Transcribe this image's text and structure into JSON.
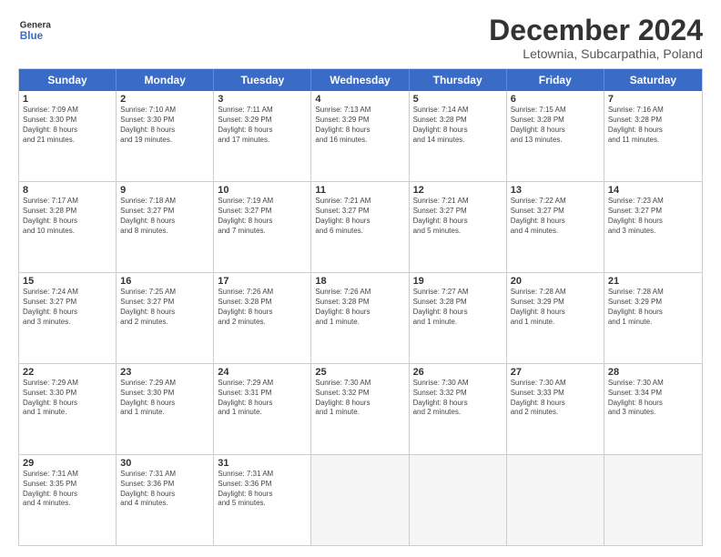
{
  "header": {
    "logo_line1": "General",
    "logo_line2": "Blue",
    "title": "December 2024",
    "subtitle": "Letownia, Subcarpathia, Poland"
  },
  "calendar": {
    "days_of_week": [
      "Sunday",
      "Monday",
      "Tuesday",
      "Wednesday",
      "Thursday",
      "Friday",
      "Saturday"
    ],
    "rows": [
      [
        {
          "day": "1",
          "info": "Sunrise: 7:09 AM\nSunset: 3:30 PM\nDaylight: 8 hours\nand 21 minutes."
        },
        {
          "day": "2",
          "info": "Sunrise: 7:10 AM\nSunset: 3:30 PM\nDaylight: 8 hours\nand 19 minutes."
        },
        {
          "day": "3",
          "info": "Sunrise: 7:11 AM\nSunset: 3:29 PM\nDaylight: 8 hours\nand 17 minutes."
        },
        {
          "day": "4",
          "info": "Sunrise: 7:13 AM\nSunset: 3:29 PM\nDaylight: 8 hours\nand 16 minutes."
        },
        {
          "day": "5",
          "info": "Sunrise: 7:14 AM\nSunset: 3:28 PM\nDaylight: 8 hours\nand 14 minutes."
        },
        {
          "day": "6",
          "info": "Sunrise: 7:15 AM\nSunset: 3:28 PM\nDaylight: 8 hours\nand 13 minutes."
        },
        {
          "day": "7",
          "info": "Sunrise: 7:16 AM\nSunset: 3:28 PM\nDaylight: 8 hours\nand 11 minutes."
        }
      ],
      [
        {
          "day": "8",
          "info": "Sunrise: 7:17 AM\nSunset: 3:28 PM\nDaylight: 8 hours\nand 10 minutes."
        },
        {
          "day": "9",
          "info": "Sunrise: 7:18 AM\nSunset: 3:27 PM\nDaylight: 8 hours\nand 8 minutes."
        },
        {
          "day": "10",
          "info": "Sunrise: 7:19 AM\nSunset: 3:27 PM\nDaylight: 8 hours\nand 7 minutes."
        },
        {
          "day": "11",
          "info": "Sunrise: 7:21 AM\nSunset: 3:27 PM\nDaylight: 8 hours\nand 6 minutes."
        },
        {
          "day": "12",
          "info": "Sunrise: 7:21 AM\nSunset: 3:27 PM\nDaylight: 8 hours\nand 5 minutes."
        },
        {
          "day": "13",
          "info": "Sunrise: 7:22 AM\nSunset: 3:27 PM\nDaylight: 8 hours\nand 4 minutes."
        },
        {
          "day": "14",
          "info": "Sunrise: 7:23 AM\nSunset: 3:27 PM\nDaylight: 8 hours\nand 3 minutes."
        }
      ],
      [
        {
          "day": "15",
          "info": "Sunrise: 7:24 AM\nSunset: 3:27 PM\nDaylight: 8 hours\nand 3 minutes."
        },
        {
          "day": "16",
          "info": "Sunrise: 7:25 AM\nSunset: 3:27 PM\nDaylight: 8 hours\nand 2 minutes."
        },
        {
          "day": "17",
          "info": "Sunrise: 7:26 AM\nSunset: 3:28 PM\nDaylight: 8 hours\nand 2 minutes."
        },
        {
          "day": "18",
          "info": "Sunrise: 7:26 AM\nSunset: 3:28 PM\nDaylight: 8 hours\nand 1 minute."
        },
        {
          "day": "19",
          "info": "Sunrise: 7:27 AM\nSunset: 3:28 PM\nDaylight: 8 hours\nand 1 minute."
        },
        {
          "day": "20",
          "info": "Sunrise: 7:28 AM\nSunset: 3:29 PM\nDaylight: 8 hours\nand 1 minute."
        },
        {
          "day": "21",
          "info": "Sunrise: 7:28 AM\nSunset: 3:29 PM\nDaylight: 8 hours\nand 1 minute."
        }
      ],
      [
        {
          "day": "22",
          "info": "Sunrise: 7:29 AM\nSunset: 3:30 PM\nDaylight: 8 hours\nand 1 minute."
        },
        {
          "day": "23",
          "info": "Sunrise: 7:29 AM\nSunset: 3:30 PM\nDaylight: 8 hours\nand 1 minute."
        },
        {
          "day": "24",
          "info": "Sunrise: 7:29 AM\nSunset: 3:31 PM\nDaylight: 8 hours\nand 1 minute."
        },
        {
          "day": "25",
          "info": "Sunrise: 7:30 AM\nSunset: 3:32 PM\nDaylight: 8 hours\nand 1 minute."
        },
        {
          "day": "26",
          "info": "Sunrise: 7:30 AM\nSunset: 3:32 PM\nDaylight: 8 hours\nand 2 minutes."
        },
        {
          "day": "27",
          "info": "Sunrise: 7:30 AM\nSunset: 3:33 PM\nDaylight: 8 hours\nand 2 minutes."
        },
        {
          "day": "28",
          "info": "Sunrise: 7:30 AM\nSunset: 3:34 PM\nDaylight: 8 hours\nand 3 minutes."
        }
      ],
      [
        {
          "day": "29",
          "info": "Sunrise: 7:31 AM\nSunset: 3:35 PM\nDaylight: 8 hours\nand 4 minutes."
        },
        {
          "day": "30",
          "info": "Sunrise: 7:31 AM\nSunset: 3:36 PM\nDaylight: 8 hours\nand 4 minutes."
        },
        {
          "day": "31",
          "info": "Sunrise: 7:31 AM\nSunset: 3:36 PM\nDaylight: 8 hours\nand 5 minutes."
        },
        {
          "day": "",
          "info": ""
        },
        {
          "day": "",
          "info": ""
        },
        {
          "day": "",
          "info": ""
        },
        {
          "day": "",
          "info": ""
        }
      ]
    ]
  }
}
